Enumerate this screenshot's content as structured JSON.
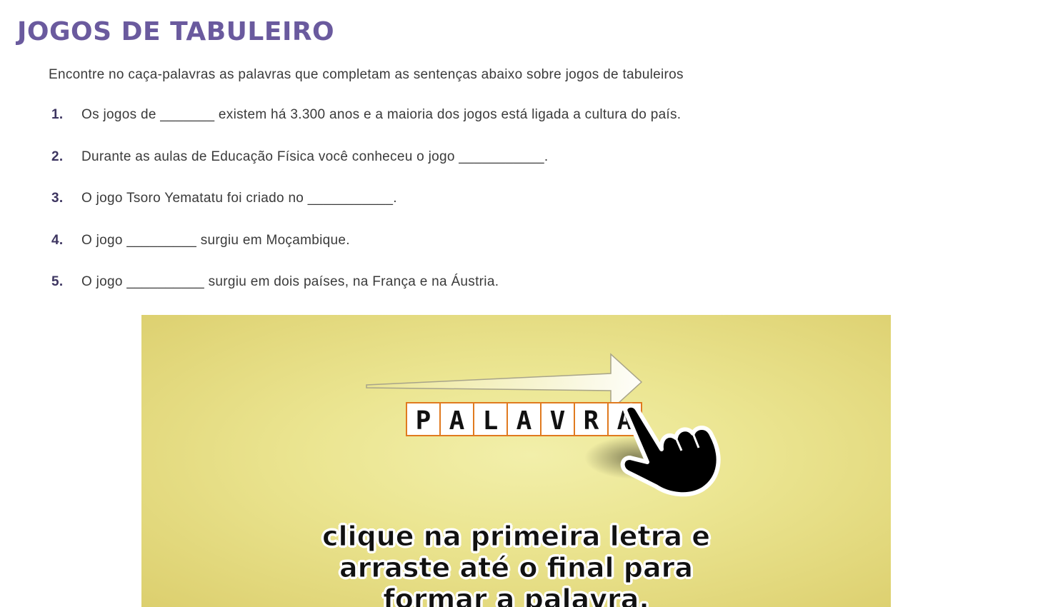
{
  "page": {
    "title": "JOGOS DE TABULEIRO",
    "intro": "Encontre no caça-palavras as palavras que completam as sentenças abaixo sobre jogos de tabuleiros"
  },
  "questions": [
    {
      "number": "1.",
      "text": "Os jogos de _______ existem há 3.300 anos e a maioria dos jogos está ligada a cultura do país."
    },
    {
      "number": "2.",
      "text": "Durante as aulas de Educação Física você conheceu o jogo ___________."
    },
    {
      "number": "3.",
      "text": "O jogo Tsoro Yematatu foi criado no ___________."
    },
    {
      "number": "4.",
      "text": "O jogo _________ surgiu em Moçambique."
    },
    {
      "number": "5.",
      "text": "O jogo __________ surgiu em dois países, na França e na Áustria."
    }
  ],
  "game": {
    "tiles": [
      "P",
      "A",
      "L",
      "A",
      "V",
      "R",
      "A"
    ],
    "instruction_lines": [
      "clique na primeira letra e",
      "arraste até o final para",
      "formar a palavra."
    ],
    "colors": {
      "title": "#6a5a9e",
      "tile_border": "#e07a1f",
      "background": "#ebe591"
    },
    "icons": [
      "arrow-right-icon",
      "pointing-hand-icon"
    ]
  }
}
